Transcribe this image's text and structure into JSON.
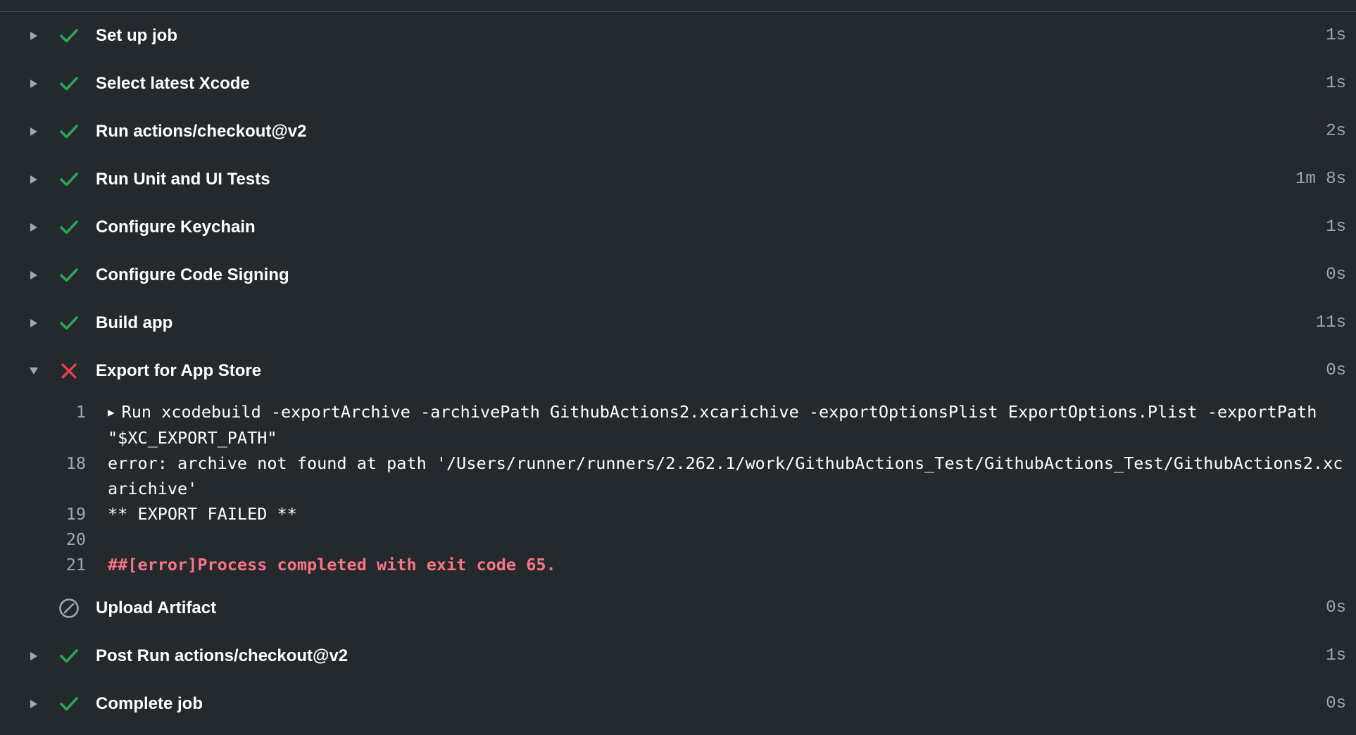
{
  "steps_before": [
    {
      "title": "Set up job",
      "duration": "1s",
      "status": "success"
    },
    {
      "title": "Select latest Xcode",
      "duration": "1s",
      "status": "success"
    },
    {
      "title": "Run actions/checkout@v2",
      "duration": "2s",
      "status": "success"
    },
    {
      "title": "Run Unit and UI Tests",
      "duration": "1m 8s",
      "status": "success"
    },
    {
      "title": "Configure Keychain",
      "duration": "1s",
      "status": "success"
    },
    {
      "title": "Configure Code Signing",
      "duration": "0s",
      "status": "success"
    },
    {
      "title": "Build app",
      "duration": "11s",
      "status": "success"
    }
  ],
  "failed_step": {
    "title": "Export for App Store",
    "duration": "0s",
    "status": "failure",
    "log": [
      {
        "ln": "1",
        "text": "Run xcodebuild -exportArchive -archivePath GithubActions2.xcarichive -exportOptionsPlist ExportOptions.Plist -exportPath \"$XC_EXPORT_PATH\"",
        "collapsible": true
      },
      {
        "ln": "18",
        "text": "error: archive not found at path '/Users/runner/runners/2.262.1/work/GithubActions_Test/GithubActions_Test/GithubActions2.xcarichive'"
      },
      {
        "ln": "19",
        "text": "** EXPORT FAILED **"
      },
      {
        "ln": "20",
        "text": ""
      },
      {
        "ln": "21",
        "text": "##[error]Process completed with exit code 65.",
        "error": true
      }
    ]
  },
  "skipped_step": {
    "title": "Upload Artifact",
    "duration": "0s",
    "status": "skipped"
  },
  "steps_after": [
    {
      "title": "Post Run actions/checkout@v2",
      "duration": "1s",
      "status": "success"
    },
    {
      "title": "Complete job",
      "duration": "0s",
      "status": "success"
    }
  ],
  "colors": {
    "background": "#24292e",
    "success": "#2ea44f",
    "failure": "#f3404b",
    "error_text": "#f97583",
    "muted": "#a0a7b0"
  }
}
